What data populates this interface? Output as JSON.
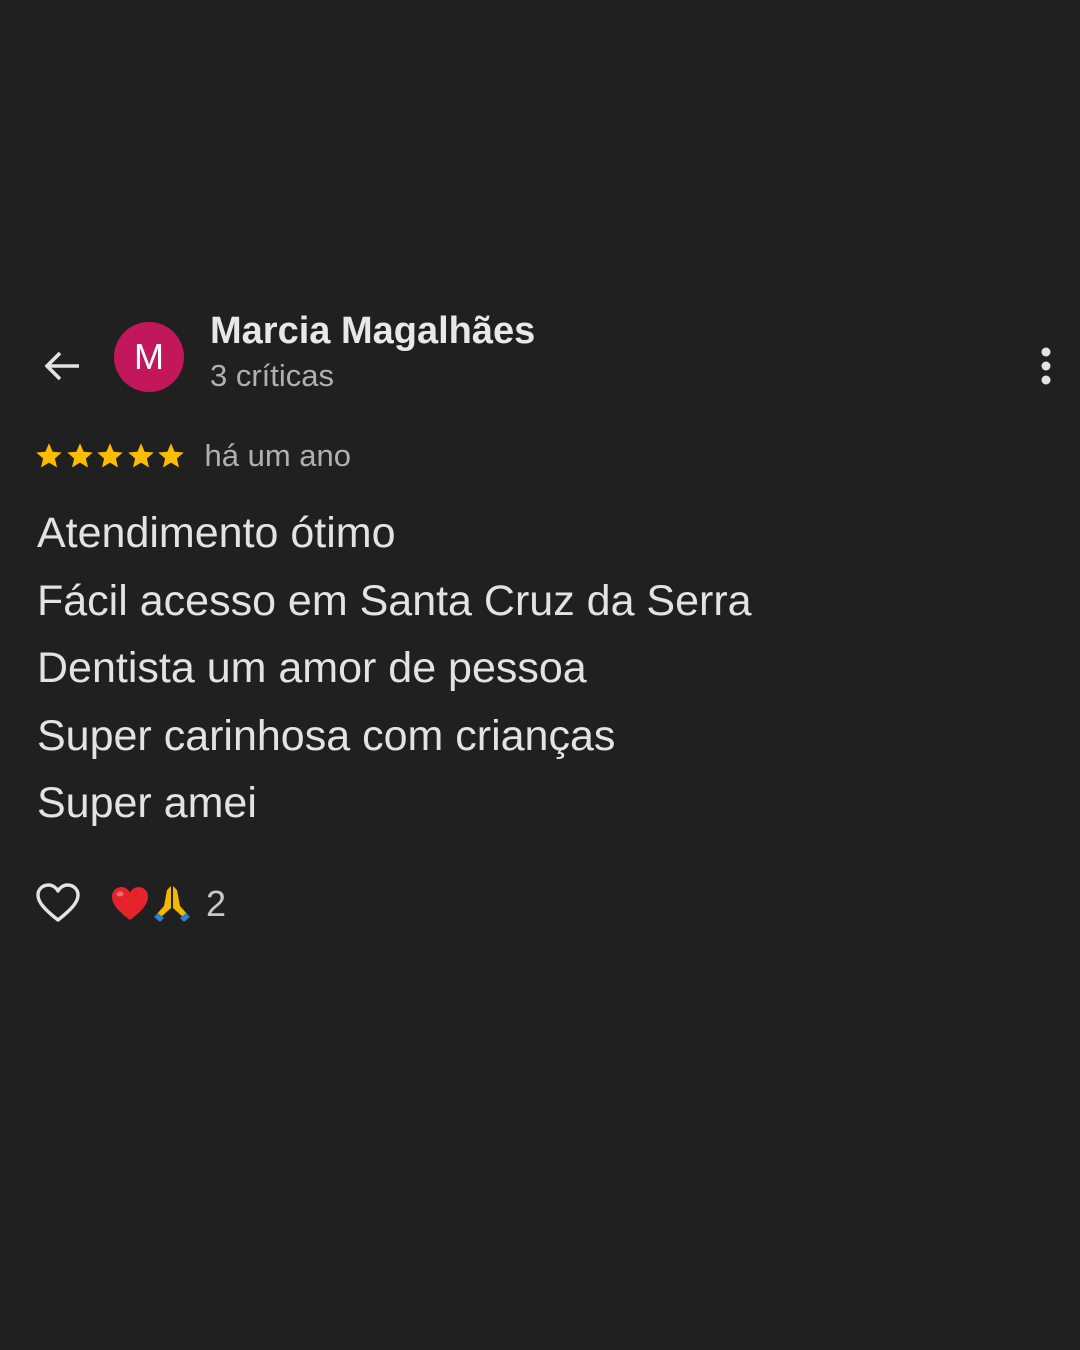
{
  "header": {
    "back_icon": "arrow-left-icon",
    "avatar_letter": "M",
    "avatar_color": "#c2185b",
    "user_name": "Marcia Magalhães",
    "review_count": "3 críticas",
    "more_icon": "more-vertical-icon"
  },
  "review": {
    "rating": 5,
    "rating_max": 5,
    "star_color": "#fbbc04",
    "time": "há um ano",
    "lines": [
      "Atendimento ótimo",
      "Fácil acesso em Santa Cruz da Serra",
      "Dentista um amor de pessoa",
      "Super carinhosa com crianças",
      "Super amei"
    ]
  },
  "reactions": {
    "like_icon": "heart-outline-icon",
    "emojis": [
      "red-heart-icon",
      "praying-hands-icon"
    ],
    "count": "2"
  }
}
